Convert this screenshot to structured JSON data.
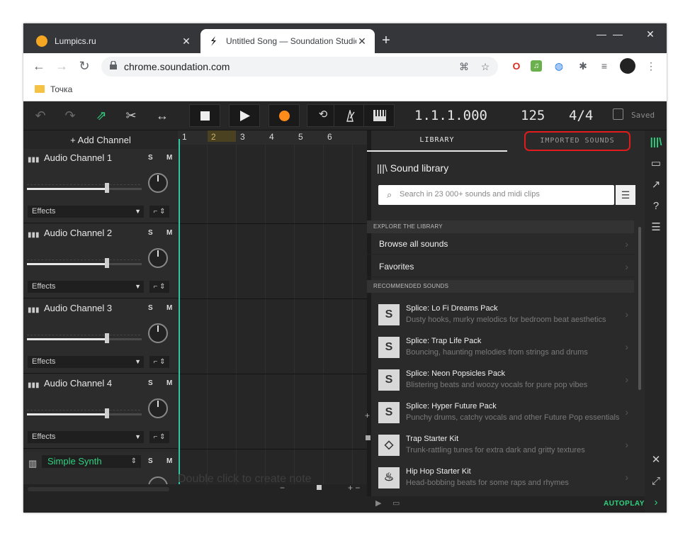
{
  "browser": {
    "tabs": [
      {
        "title": "Lumpics.ru",
        "favicon_color": "#f5a623"
      },
      {
        "title": "Untitled Song — Soundation Studio",
        "favicon_color": "#111111"
      }
    ],
    "new_tab": "+",
    "window_controls": {
      "minimize": "—",
      "maximize": "☐",
      "close": "✕"
    },
    "url": "chrome.soundation.com",
    "bookmark": "Точка"
  },
  "studio": {
    "position": "1.1.1.000",
    "tempo": "125",
    "signature": "4/4",
    "saved": "Saved",
    "add_channel": "+ Add Channel",
    "channels": [
      {
        "name": "Audio Channel 1",
        "effects": "Effects"
      },
      {
        "name": "Audio Channel 2",
        "effects": "Effects"
      },
      {
        "name": "Audio Channel 3",
        "effects": "Effects"
      },
      {
        "name": "Audio Channel 4",
        "effects": "Effects"
      }
    ],
    "solo": "S",
    "mute": "M",
    "synth": "Simple Synth",
    "ruler": [
      "1",
      "2",
      "3",
      "4",
      "5",
      "6"
    ],
    "hint": "Double click to create note"
  },
  "library": {
    "tab_library": "LIBRARY",
    "tab_imported": "IMPORTED SOUNDS",
    "heading": "Sound library",
    "search_placeholder": "Search in 23 000+ sounds and midi clips",
    "explore_label": "EXPLORE THE LIBRARY",
    "browse_all": "Browse all sounds",
    "favorites": "Favorites",
    "recommended_label": "RECOMMENDED SOUNDS",
    "packs": [
      {
        "title": "Splice: Lo Fi Dreams Pack",
        "desc": "Dusty hooks, murky melodics for bedroom beat aesthetics"
      },
      {
        "title": "Splice: Trap Life Pack",
        "desc": "Bouncing, haunting melodies from strings and drums"
      },
      {
        "title": "Splice: Neon Popsicles Pack",
        "desc": "Blistering beats and woozy vocals for pure pop vibes"
      },
      {
        "title": "Splice: Hyper Future Pack",
        "desc": "Punchy drums, catchy vocals and other Future Pop essentials"
      },
      {
        "title": "Trap Starter Kit",
        "desc": "Trunk-rattling tunes for extra dark and gritty textures"
      },
      {
        "title": "Hip Hop Starter Kit",
        "desc": "Head-bobbing beats for some raps and rhymes"
      }
    ],
    "autoplay": "AUTOPLAY"
  },
  "colors": {
    "accent_green": "#30d27f",
    "playhead": "#2fc8a5",
    "highlight_red": "#e01b1b",
    "record": "#ff8c1a"
  }
}
